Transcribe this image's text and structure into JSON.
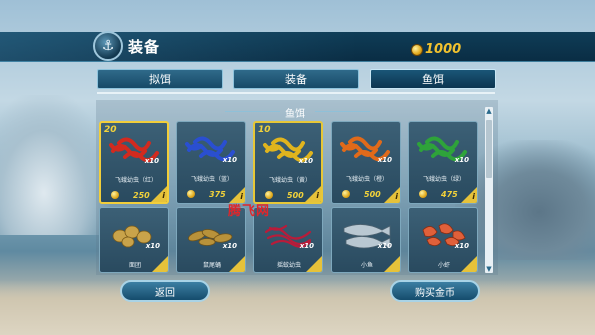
{
  "header": {
    "title": "装备",
    "coins": "1000",
    "colors": {
      "coin_text": "#f2c22e",
      "bar": "#0f3d57"
    }
  },
  "tabs": [
    {
      "label": "拟饵",
      "active": false
    },
    {
      "label": "装备",
      "active": false
    },
    {
      "label": "鱼饵",
      "active": true
    }
  ],
  "section": {
    "title": "鱼饵"
  },
  "items": [
    {
      "name": "飞蛾幼虫（红）",
      "qty": "x10",
      "price": "250",
      "badge": "20",
      "icon": "red-worms-icon",
      "selected": true
    },
    {
      "name": "飞蛾幼虫（蓝）",
      "qty": "x10",
      "price": "375",
      "badge": "",
      "icon": "blue-worms-icon",
      "selected": false
    },
    {
      "name": "飞蛾幼虫（黄）",
      "qty": "x10",
      "price": "500",
      "badge": "10",
      "icon": "yellow-worms-icon",
      "selected": false
    },
    {
      "name": "飞蛾幼虫（橙）",
      "qty": "x10",
      "price": "500",
      "badge": "",
      "icon": "orange-worms-icon",
      "selected": false
    },
    {
      "name": "飞蛾幼虫（绿）",
      "qty": "x10",
      "price": "475",
      "badge": "",
      "icon": "green-worms-icon",
      "selected": false
    },
    {
      "name": "面团",
      "qty": "x10",
      "icon": "dough-icon"
    },
    {
      "name": "鼠尾蛹",
      "qty": "x10",
      "icon": "larvae-icon"
    },
    {
      "name": "摇蚊幼虫",
      "qty": "x10",
      "icon": "bloodworm-icon"
    },
    {
      "name": "小鱼",
      "qty": "x10",
      "icon": "small-fish-icon"
    },
    {
      "name": "小虾",
      "qty": "x10",
      "icon": "shrimp-icon"
    }
  ],
  "watermark": "腾飞网",
  "buttons": {
    "back": "返回",
    "buy_coins": "购买金币"
  },
  "info_glyph": "i",
  "scroll": {
    "up": "▲",
    "down": "▼"
  },
  "header_icon_glyph": "⚓"
}
